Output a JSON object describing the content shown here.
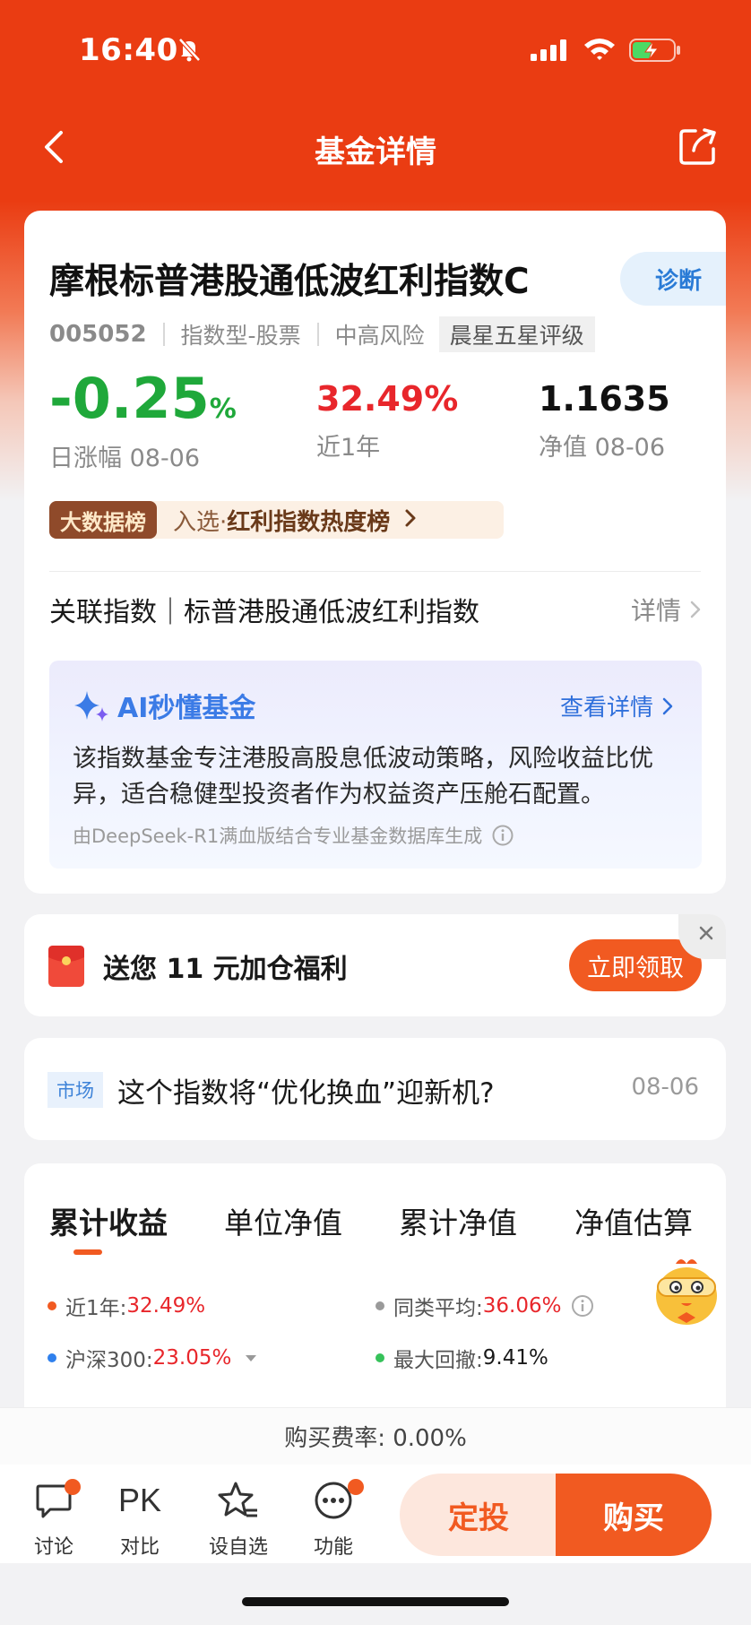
{
  "status_bar": {
    "time": "16:40"
  },
  "nav": {
    "title": "基金详情"
  },
  "fund": {
    "name": "摩根标普港股通低波红利指数C",
    "diagnose_label": "诊断",
    "code": "005052",
    "type": "指数型-股票",
    "risk": "中高风险",
    "rating": "晨星五星评级"
  },
  "stats": {
    "daily_change": {
      "value": "-0.25",
      "unit": "%",
      "label": "日涨幅 08-06"
    },
    "one_year": {
      "value": "32.49%",
      "label": "近1年"
    },
    "nav": {
      "value": "1.1635",
      "label": "净值 08-06"
    }
  },
  "bigdata": {
    "badge": "大数据榜",
    "prefix": "入选·",
    "highlight": "红利指数热度榜"
  },
  "related_index": {
    "text": "关联指数｜标普港股通低波红利指数",
    "detail": "详情"
  },
  "ai": {
    "title": "AI秒懂基金",
    "link": "查看详情",
    "body": "该指数基金专注港股高股息低波动策略，风险收益比优异，适合稳健型投资者作为权益资产压舱石配置。",
    "source": "由DeepSeek-R1满血版结合专业基金数据库生成"
  },
  "promo": {
    "text": "送您 11 元加仓福利",
    "button": "立即领取"
  },
  "news": {
    "tag": "市场",
    "title": "这个指数将“优化换血”迎新机?",
    "date": "08-06"
  },
  "chart_tabs": [
    "累计收益",
    "单位净值",
    "累计净值",
    "净值估算"
  ],
  "legend": {
    "one_year": {
      "label": "近1年:",
      "value": "32.49%",
      "color": "#f15a21"
    },
    "category_avg": {
      "label": "同类平均:",
      "value": "36.06%",
      "color": "#9a9a9a"
    },
    "hs300": {
      "label": "沪深300:",
      "value": "23.05%",
      "color": "#2f80ed"
    },
    "max_drawdown": {
      "label": "最大回撤:",
      "value": "9.41%",
      "color": "#36c25a"
    }
  },
  "fee": {
    "text": "购买费率: 0.00%"
  },
  "bottom_bar": {
    "discuss": "讨论",
    "pk_glyph": "PK",
    "compare": "对比",
    "watchlist": "设自选",
    "functions": "功能",
    "sip": "定投",
    "buy": "购买"
  },
  "colors": {
    "brand": "#ea3c12",
    "accent": "#f15a21",
    "up": "#e8262b",
    "down": "#1fa83a",
    "link": "#2f6fdb"
  },
  "icons": [
    "bell-muted-icon",
    "signal-icon",
    "wifi-icon",
    "battery-charging-icon",
    "back-arrow-icon",
    "share-icon",
    "sparkle-icon",
    "chevron-right-icon",
    "info-icon",
    "close-icon",
    "red-packet-icon",
    "chat-icon",
    "star-icon",
    "more-icon",
    "mascot-icon"
  ]
}
